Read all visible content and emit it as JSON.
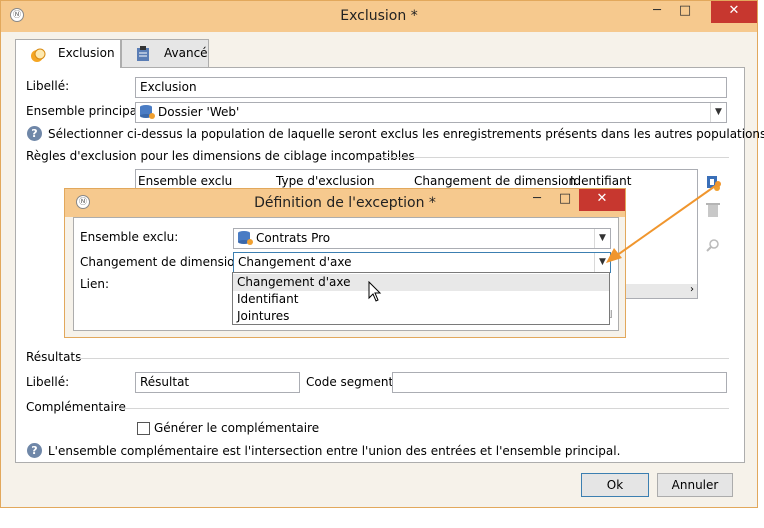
{
  "window": {
    "title": "Exclusion *",
    "minimize": "─",
    "maximize": "□",
    "close": "✕"
  },
  "tabs": [
    {
      "label": "Exclusion",
      "active": true
    },
    {
      "label": "Avancé",
      "active": false
    }
  ],
  "form": {
    "libelle_label": "Libellé:",
    "libelle_value": "Exclusion",
    "ensemble_label": "Ensemble principal:",
    "ensemble_value": "Dossier 'Web'",
    "help_text": "Sélectionner ci-dessus la population de laquelle seront exclus les enregistrements présents dans les autres populations.",
    "rules_section": "Règles d'exclusion pour les dimensions de ciblage incompatibles",
    "columns": [
      "Ensemble exclu",
      "Type d'exclusion",
      "Changement de dimension",
      "Identifiant"
    ],
    "results_section": "Résultats",
    "result_libelle_label": "Libellé:",
    "result_libelle_value": "Résultat",
    "code_segment_label": "Code segment:",
    "code_segment_value": "",
    "complementary_section": "Complémentaire",
    "generate_label": "Générer le complémentaire",
    "generate_checked": false,
    "complementary_help": "L'ensemble complémentaire est l'intersection entre l'union des entrées et l'ensemble principal."
  },
  "buttons": {
    "ok": "Ok",
    "cancel": "Annuler"
  },
  "dialog": {
    "title": "Définition de l'exception *",
    "minimize": "─",
    "maximize": "□",
    "close": "✕",
    "ensemble_label": "Ensemble exclu:",
    "ensemble_value": "Contrats Pro",
    "changement_label": "Changement de dimension:",
    "changement_value": "Changement d'axe",
    "lien_label": "Lien:",
    "options": [
      "Changement d'axe",
      "Identifiant",
      "Jointures"
    ],
    "selected_option": 0
  },
  "colors": {
    "accent": "#f6c98e",
    "annotation_arrow": "#f0962e",
    "close_red": "#c7372f"
  }
}
